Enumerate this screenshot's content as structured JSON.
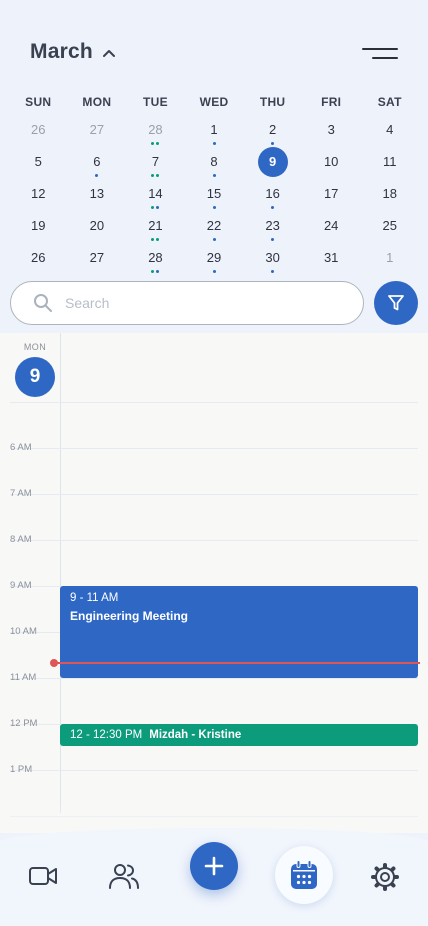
{
  "header": {
    "month": "March"
  },
  "calendar": {
    "weekdays": [
      "SUN",
      "MON",
      "TUE",
      "WED",
      "THU",
      "FRI",
      "SAT"
    ],
    "weeks": [
      [
        {
          "d": "26",
          "muted": true
        },
        {
          "d": "27",
          "muted": true
        },
        {
          "d": "28",
          "muted": true,
          "dots": "gg"
        },
        {
          "d": "1",
          "dots": "b"
        },
        {
          "d": "2",
          "dots": "b"
        },
        {
          "d": "3"
        },
        {
          "d": "4"
        }
      ],
      [
        {
          "d": "5"
        },
        {
          "d": "6",
          "dots": "b"
        },
        {
          "d": "7",
          "dots": "gg"
        },
        {
          "d": "8",
          "dots": "b"
        },
        {
          "d": "9",
          "selected": true
        },
        {
          "d": "10"
        },
        {
          "d": "11"
        }
      ],
      [
        {
          "d": "12"
        },
        {
          "d": "13"
        },
        {
          "d": "14",
          "dots": "gb"
        },
        {
          "d": "15",
          "dots": "b"
        },
        {
          "d": "16",
          "dots": "b"
        },
        {
          "d": "17"
        },
        {
          "d": "18"
        }
      ],
      [
        {
          "d": "19"
        },
        {
          "d": "20"
        },
        {
          "d": "21",
          "dots": "gg"
        },
        {
          "d": "22",
          "dots": "b"
        },
        {
          "d": "23",
          "dots": "b"
        },
        {
          "d": "24"
        },
        {
          "d": "25"
        }
      ],
      [
        {
          "d": "26"
        },
        {
          "d": "27"
        },
        {
          "d": "28",
          "dots": "gb"
        },
        {
          "d": "29",
          "dots": "b"
        },
        {
          "d": "30",
          "dots": "b"
        },
        {
          "d": "31"
        },
        {
          "d": "1",
          "muted": true
        }
      ]
    ]
  },
  "search": {
    "placeholder": "Search"
  },
  "day_view": {
    "weekday": "MON",
    "date": "9",
    "hours": [
      "6 AM",
      "7 AM",
      "8 AM",
      "9 AM",
      "10 AM",
      "11 AM",
      "12 PM",
      "1 PM"
    ]
  },
  "events": [
    {
      "time": "9 - 11 AM",
      "title": "Engineering Meeting",
      "color": "#2f68c4"
    },
    {
      "time": "12 - 12:30 PM",
      "title": "Mizdah - Kristine",
      "color": "#0c9c7c"
    }
  ],
  "colors": {
    "accent": "#2f68c4",
    "green": "#0c9c7c",
    "now": "#e05656"
  },
  "bottom_nav": [
    "video-icon",
    "people-icon",
    "plus-icon",
    "calendar-icon",
    "gear-icon"
  ]
}
